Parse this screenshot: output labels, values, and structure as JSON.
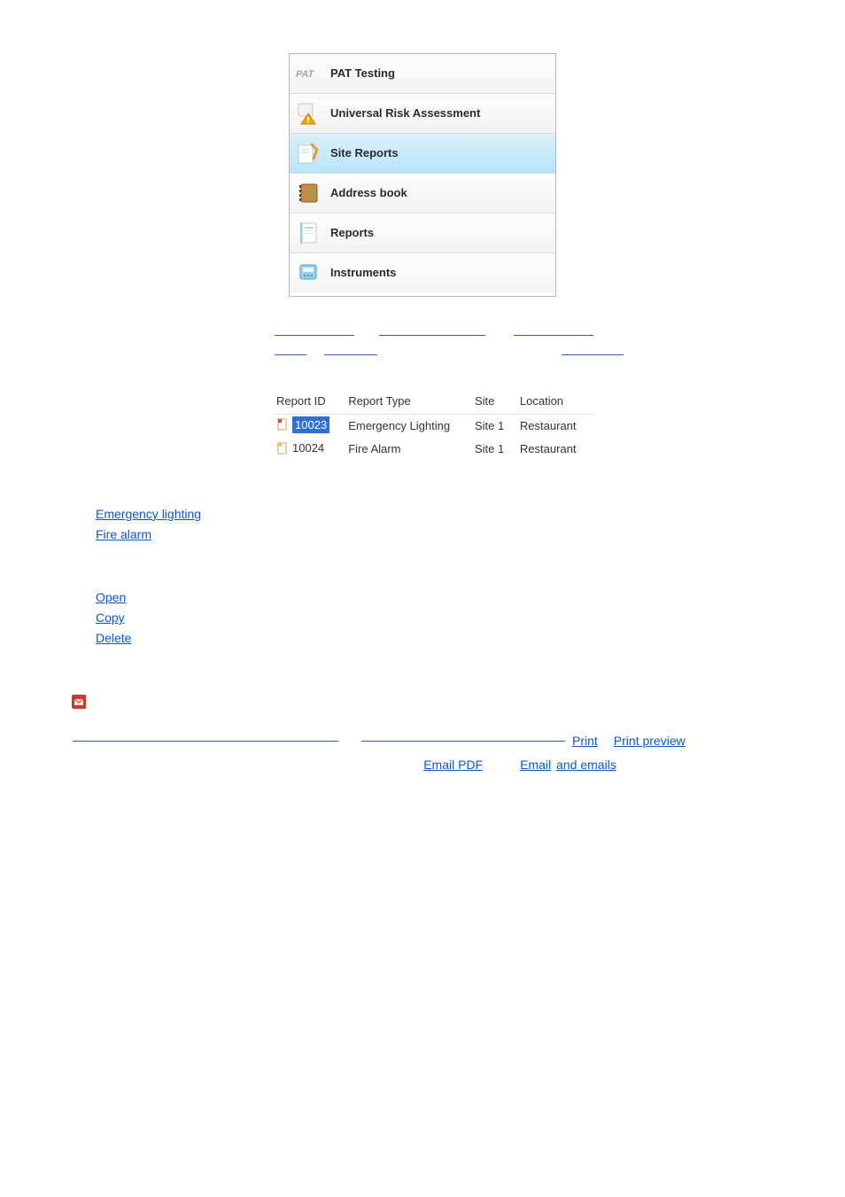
{
  "nav": {
    "items": [
      {
        "label": "PAT Testing",
        "icon": "pat-icon"
      },
      {
        "label": "Universal Risk Assessment",
        "icon": "risk-icon"
      },
      {
        "label": "Site Reports",
        "icon": "site-reports-icon",
        "selected": true
      },
      {
        "label": "Address book",
        "icon": "address-book-icon"
      },
      {
        "label": "Reports",
        "icon": "reports-icon"
      },
      {
        "label": "Instruments",
        "icon": "instruments-icon"
      }
    ]
  },
  "table": {
    "columns": [
      "Report ID",
      "Report Type",
      "Site",
      "Location"
    ],
    "rows": [
      {
        "id": "10023",
        "type": "Emergency Lighting",
        "site": "Site 1",
        "location": "Restaurant",
        "selected": true
      },
      {
        "id": "10024",
        "type": "Fire Alarm",
        "site": "Site 1",
        "location": "Restaurant",
        "selected": false
      }
    ]
  },
  "links_section1": [
    "Emergency lighting",
    "Fire alarm"
  ],
  "links_section2": [
    "Open",
    "Copy",
    "Delete"
  ],
  "links_section3": {
    "row1_links": [
      "Print",
      "Print preview"
    ],
    "row2_links": [
      "Email PDF",
      "Email",
      "and emails"
    ]
  }
}
